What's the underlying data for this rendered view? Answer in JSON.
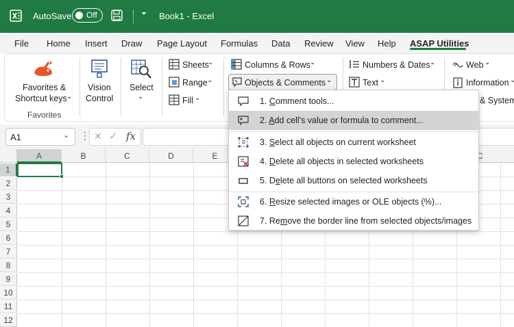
{
  "titlebar": {
    "autosave_label": "AutoSave",
    "autosave_state": "Off",
    "title": "Book1  -  Excel",
    "qa_dropdown": "⏷"
  },
  "tabs": [
    "File",
    "Home",
    "Insert",
    "Draw",
    "Page Layout",
    "Formulas",
    "Data",
    "Review",
    "View",
    "Help",
    "ASAP Utilities"
  ],
  "active_tab": "ASAP Utilities",
  "ribbon": {
    "favorites_line1": "Favorites &",
    "favorites_line2": "Shortcut keys",
    "favorites_group": "Favorites",
    "vision_line1": "Vision",
    "vision_line2": "Control",
    "select_label": "Select",
    "sheets": "Sheets",
    "range": "Range",
    "fill": "Fill",
    "columns_rows": "Columns & Rows",
    "objects_comments": "Objects & Comments",
    "numbers_dates": "Numbers & Dates",
    "text": "Text",
    "web": "Web",
    "information": "Information",
    "system": "& System",
    "chevron": "⌄"
  },
  "formula_bar": {
    "name_box": "A1",
    "fx": "fx",
    "dots": "⋮",
    "cancel": "✕",
    "enter": "✓"
  },
  "grid": {
    "columns": [
      "A",
      "B",
      "C",
      "D",
      "E",
      "",
      "",
      "",
      "",
      "",
      "C"
    ],
    "rows": [
      "1",
      "2",
      "3",
      "4",
      "5",
      "6",
      "7",
      "8",
      "9",
      "10",
      "11",
      "12"
    ],
    "active_cell": "A1"
  },
  "menu": {
    "items": [
      {
        "pre": "1. ",
        "u": "C",
        "post": "omment tools..."
      },
      {
        "pre": "2. ",
        "u": "A",
        "post": "dd cell's value or formula to comment..."
      },
      {
        "pre": "3. ",
        "u": "S",
        "post": "elect all objects on current worksheet"
      },
      {
        "pre": "4. ",
        "u": "D",
        "post": "elete all objects in selected worksheets"
      },
      {
        "pre": "5. D",
        "u": "e",
        "post": "lete all buttons on selected worksheets"
      },
      {
        "pre": "6. ",
        "u": "R",
        "post": "esize selected images or OLE objects (%)..."
      },
      {
        "pre": "7. Re",
        "u": "m",
        "post": "ove the border line from selected objects/images"
      }
    ],
    "highlighted_index": 1
  },
  "colors": {
    "brand_green": "#1f7a43",
    "menu_highlight": "#d4d4d4"
  }
}
